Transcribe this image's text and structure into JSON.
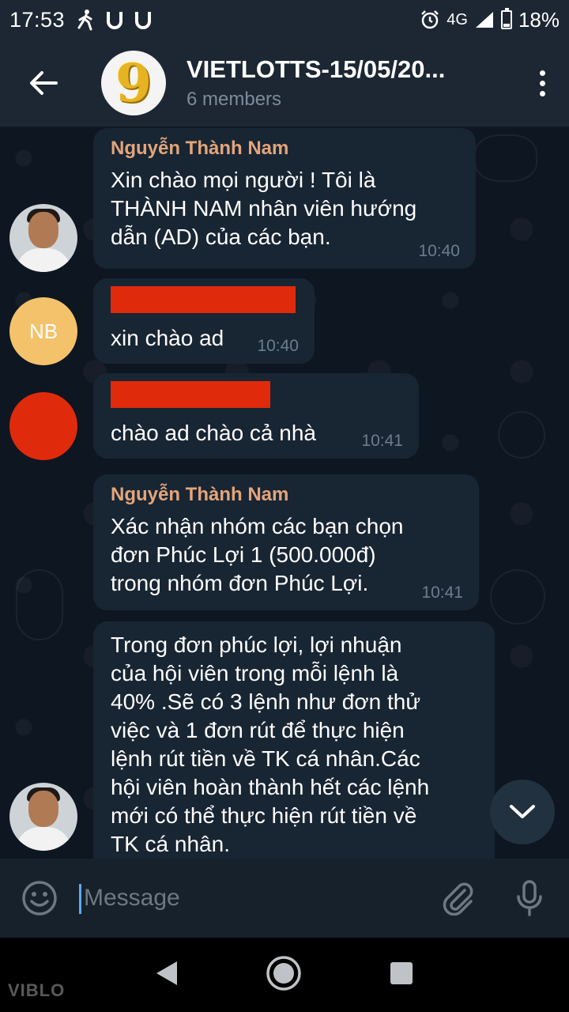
{
  "status_bar": {
    "time": "17:53",
    "network": "4G",
    "battery": "18%",
    "icons": [
      "walking-icon",
      "u-icon",
      "u-icon",
      "alarm-icon",
      "signal-icon",
      "battery-icon"
    ]
  },
  "header": {
    "title": "VIETLOTTS-15/05/20...",
    "subtitle": "6 members",
    "avatar_digit": "9"
  },
  "messages": [
    {
      "sender": "Nguyễn Thành Nam",
      "text": "Xin chào mọi người ! Tôi là\nTHÀNH NAM nhân viên hướng\ndẫn (AD) của các bạn.",
      "time": "10:40"
    },
    {
      "sender_initials": "NB",
      "text": "xin chào ad",
      "time": "10:40"
    },
    {
      "text": "chào ad chào cả nhà",
      "time": "10:41"
    },
    {
      "sender": "Nguyễn Thành Nam",
      "text": "Xác nhận nhóm các bạn chọn\nđơn Phúc Lợi 1 (500.000đ)\ntrong nhóm đơn Phúc Lợi.",
      "time": "10:41"
    },
    {
      "text": "Trong đơn phúc lợi, lợi nhuận\ncủa hội viên trong mỗi lệnh là\n40% .Sẽ có 3 lệnh như đơn thử\nviệc và 1 đơn rút để thực hiện\nlệnh rút tiền về TK cá nhân.Các\nhội viên hoàn thành hết các lệnh\nmới có thể thực hiện rút tiền về\nTK cá nhân."
    }
  ],
  "input": {
    "placeholder": "Message"
  },
  "watermark": "VIBLO",
  "colors": {
    "background": "#0e1621",
    "header": "#1c2733",
    "bubble": "#182533",
    "sender_name": "#e4a57a",
    "redaction": "#e02a0c"
  }
}
